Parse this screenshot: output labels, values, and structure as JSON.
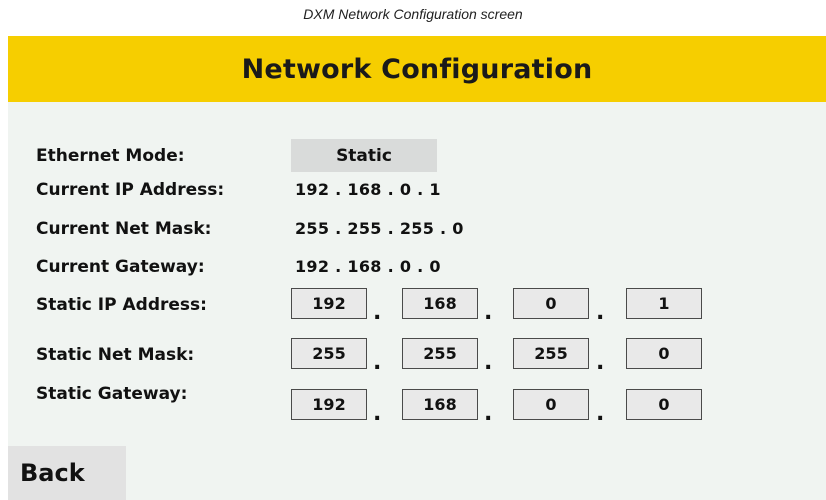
{
  "caption": "DXM Network Configuration screen",
  "header": {
    "title": "Network Configuration"
  },
  "colors": {
    "header_bg": "#f6ce00",
    "screen_bg": "#f0f4f1",
    "field_bg": "#e9e9e9"
  },
  "ethernet_mode": {
    "label": "Ethernet Mode:",
    "value": "Static"
  },
  "current": {
    "ip": {
      "label": "Current IP Address:",
      "value": "192 . 168 . 0 . 1"
    },
    "mask": {
      "label": "Current Net Mask:",
      "value": "255 . 255 . 255 . 0"
    },
    "gateway": {
      "label": "Current Gateway:",
      "value": "192 . 168 . 0 . 0"
    }
  },
  "static": {
    "ip": {
      "label": "Static IP Address:",
      "octets": [
        "192",
        "168",
        "0",
        "1"
      ]
    },
    "mask": {
      "label": "Static Net Mask:",
      "octets": [
        "255",
        "255",
        "255",
        "0"
      ]
    },
    "gateway": {
      "label": "Static Gateway:",
      "octets": [
        "192",
        "168",
        "0",
        "0"
      ]
    }
  },
  "separator": ".",
  "back_button": {
    "label": "Back"
  }
}
